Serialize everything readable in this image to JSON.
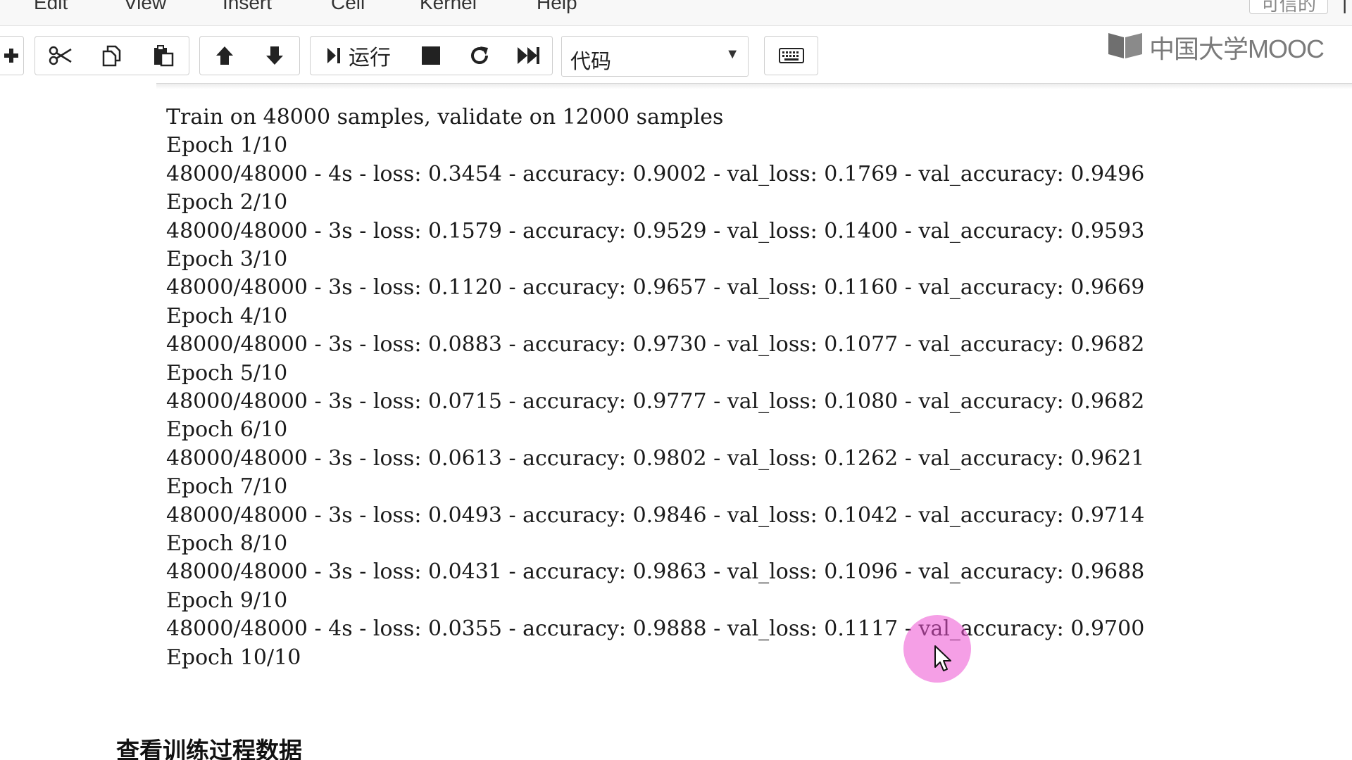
{
  "menu": {
    "items": [
      "Edit",
      "View",
      "Insert",
      "Cell",
      "Kernel",
      "Help"
    ],
    "trusted_label": "可信的"
  },
  "toolbar": {
    "run_label": "运行",
    "cell_type": "代码",
    "icons": [
      "insert-cell-below-icon",
      "cut-icon",
      "copy-icon",
      "paste-icon",
      "move-up-icon",
      "move-down-icon",
      "run-icon",
      "stop-icon",
      "restart-icon",
      "restart-run-all-icon",
      "keyboard-icon"
    ]
  },
  "watermark": {
    "text": "中国大学MOOC"
  },
  "output": {
    "lines": [
      "Train on 48000 samples, validate on 12000 samples",
      "Epoch 1/10",
      "48000/48000 - 4s - loss: 0.3454 - accuracy: 0.9002 - val_loss: 0.1769 - val_accuracy: 0.9496",
      "Epoch 2/10",
      "48000/48000 - 3s - loss: 0.1579 - accuracy: 0.9529 - val_loss: 0.1400 - val_accuracy: 0.9593",
      "Epoch 3/10",
      "48000/48000 - 3s - loss: 0.1120 - accuracy: 0.9657 - val_loss: 0.1160 - val_accuracy: 0.9669",
      "Epoch 4/10",
      "48000/48000 - 3s - loss: 0.0883 - accuracy: 0.9730 - val_loss: 0.1077 - val_accuracy: 0.9682",
      "Epoch 5/10",
      "48000/48000 - 3s - loss: 0.0715 - accuracy: 0.9777 - val_loss: 0.1080 - val_accuracy: 0.9682",
      "Epoch 6/10",
      "48000/48000 - 3s - loss: 0.0613 - accuracy: 0.9802 - val_loss: 0.1262 - val_accuracy: 0.9621",
      "Epoch 7/10",
      "48000/48000 - 3s - loss: 0.0493 - accuracy: 0.9846 - val_loss: 0.1042 - val_accuracy: 0.9714",
      "Epoch 8/10",
      "48000/48000 - 3s - loss: 0.0431 - accuracy: 0.9863 - val_loss: 0.1096 - val_accuracy: 0.9688",
      "Epoch 9/10",
      "48000/48000 - 4s - loss: 0.0355 - accuracy: 0.9888 - val_loss: 0.1117 - val_accuracy: 0.9700",
      "Epoch 10/10"
    ]
  },
  "section_heading": "查看训练过程数据",
  "colors": {
    "cursor_halo": "#ec50d2",
    "toolbar_border": "#cfcfcf"
  }
}
